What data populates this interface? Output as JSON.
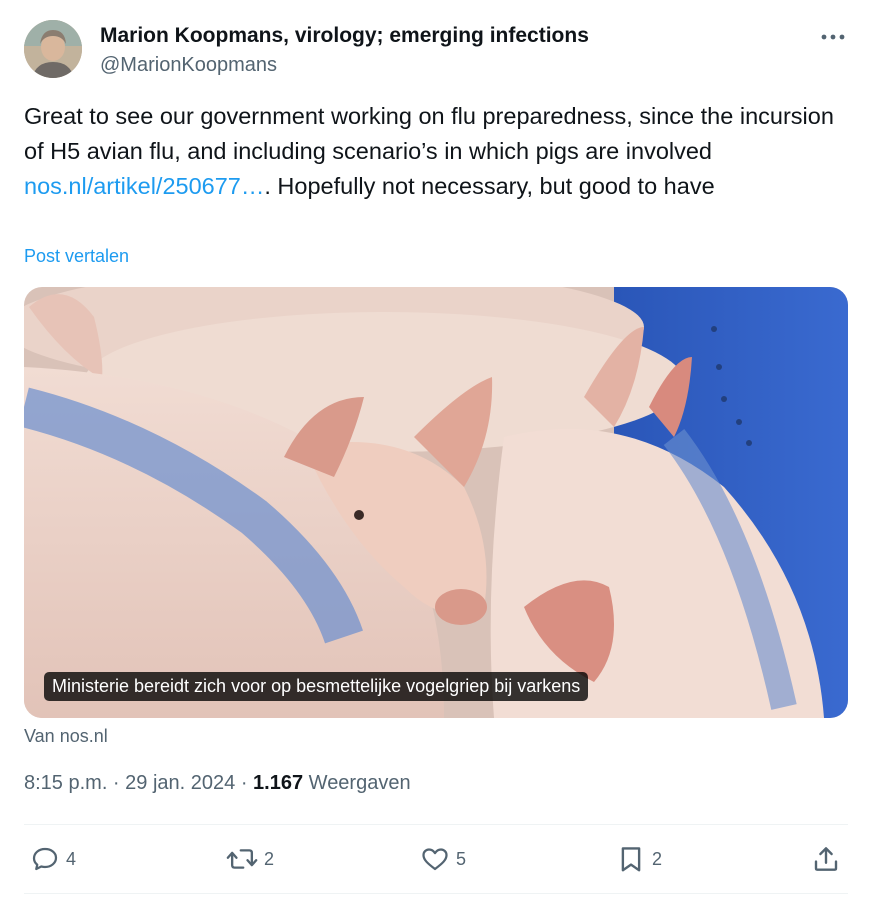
{
  "author": {
    "display_name": "Marion Koopmans, virology; emerging infections",
    "handle": "@MarionKoopmans",
    "avatar_icon": "user-photo"
  },
  "tweet": {
    "text_before_link": "Great to see our government working on flu preparedness, since the incursion of H5 avian flu, and including scenario’s in which pigs are involved ",
    "link_text": "nos.nl/artikel/250677…",
    "text_after_link": ". Hopefully not necessary, but good to have",
    "translate_label": "Post vertalen"
  },
  "card": {
    "caption": "Ministerie bereidt zich voor op besmettelijke vogelgriep bij varkens",
    "source": "Van nos.nl"
  },
  "meta": {
    "time_date": "8:15 p.m. · 29 jan. 2024",
    "separator": "·",
    "views_count": "1.167",
    "views_label": "Weergaven"
  },
  "actions": {
    "replies": "4",
    "reposts": "2",
    "likes": "5",
    "bookmarks": "2"
  },
  "colors": {
    "accent": "#1d9bf0",
    "secondary_text": "#536471",
    "primary_text": "#0f1419"
  }
}
